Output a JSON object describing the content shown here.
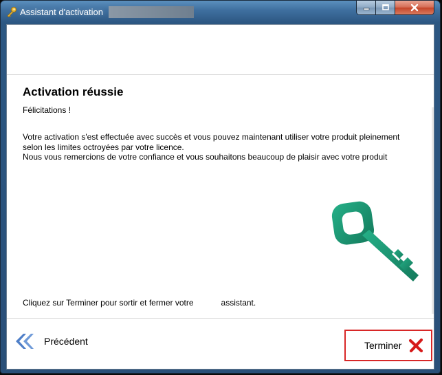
{
  "window": {
    "title": "Assistant d'activation",
    "icon": "key-icon"
  },
  "caption_buttons": {
    "minimize_icon": "minimize-icon",
    "maximize_icon": "maximize-icon",
    "close_icon": "close-icon"
  },
  "content": {
    "heading": "Activation réussie",
    "subheading": "Félicitations !",
    "body_lines": [
      "Votre activation s'est effectuée avec succès et vous pouvez maintenant utiliser votre produit pleinement",
      "selon les limites octroyées par votre licence.",
      " Nous vous remercions de votre confiance et vous souhaitons beaucoup de plaisir avec votre produit"
    ],
    "finish_hint": "Cliquez sur Terminer pour sortir et fermer votre            assistant.",
    "graphic_icon": "key-graphic-icon"
  },
  "footer": {
    "prev_label": "Précédent",
    "prev_icon": "double-chevron-left-icon",
    "finish_label": "Terminer",
    "finish_icon": "red-x-icon"
  },
  "colors": {
    "titlebar": "#2c5782",
    "close_button": "#c44428",
    "key_green": "#1f9a76",
    "highlight_border": "#d82727"
  }
}
